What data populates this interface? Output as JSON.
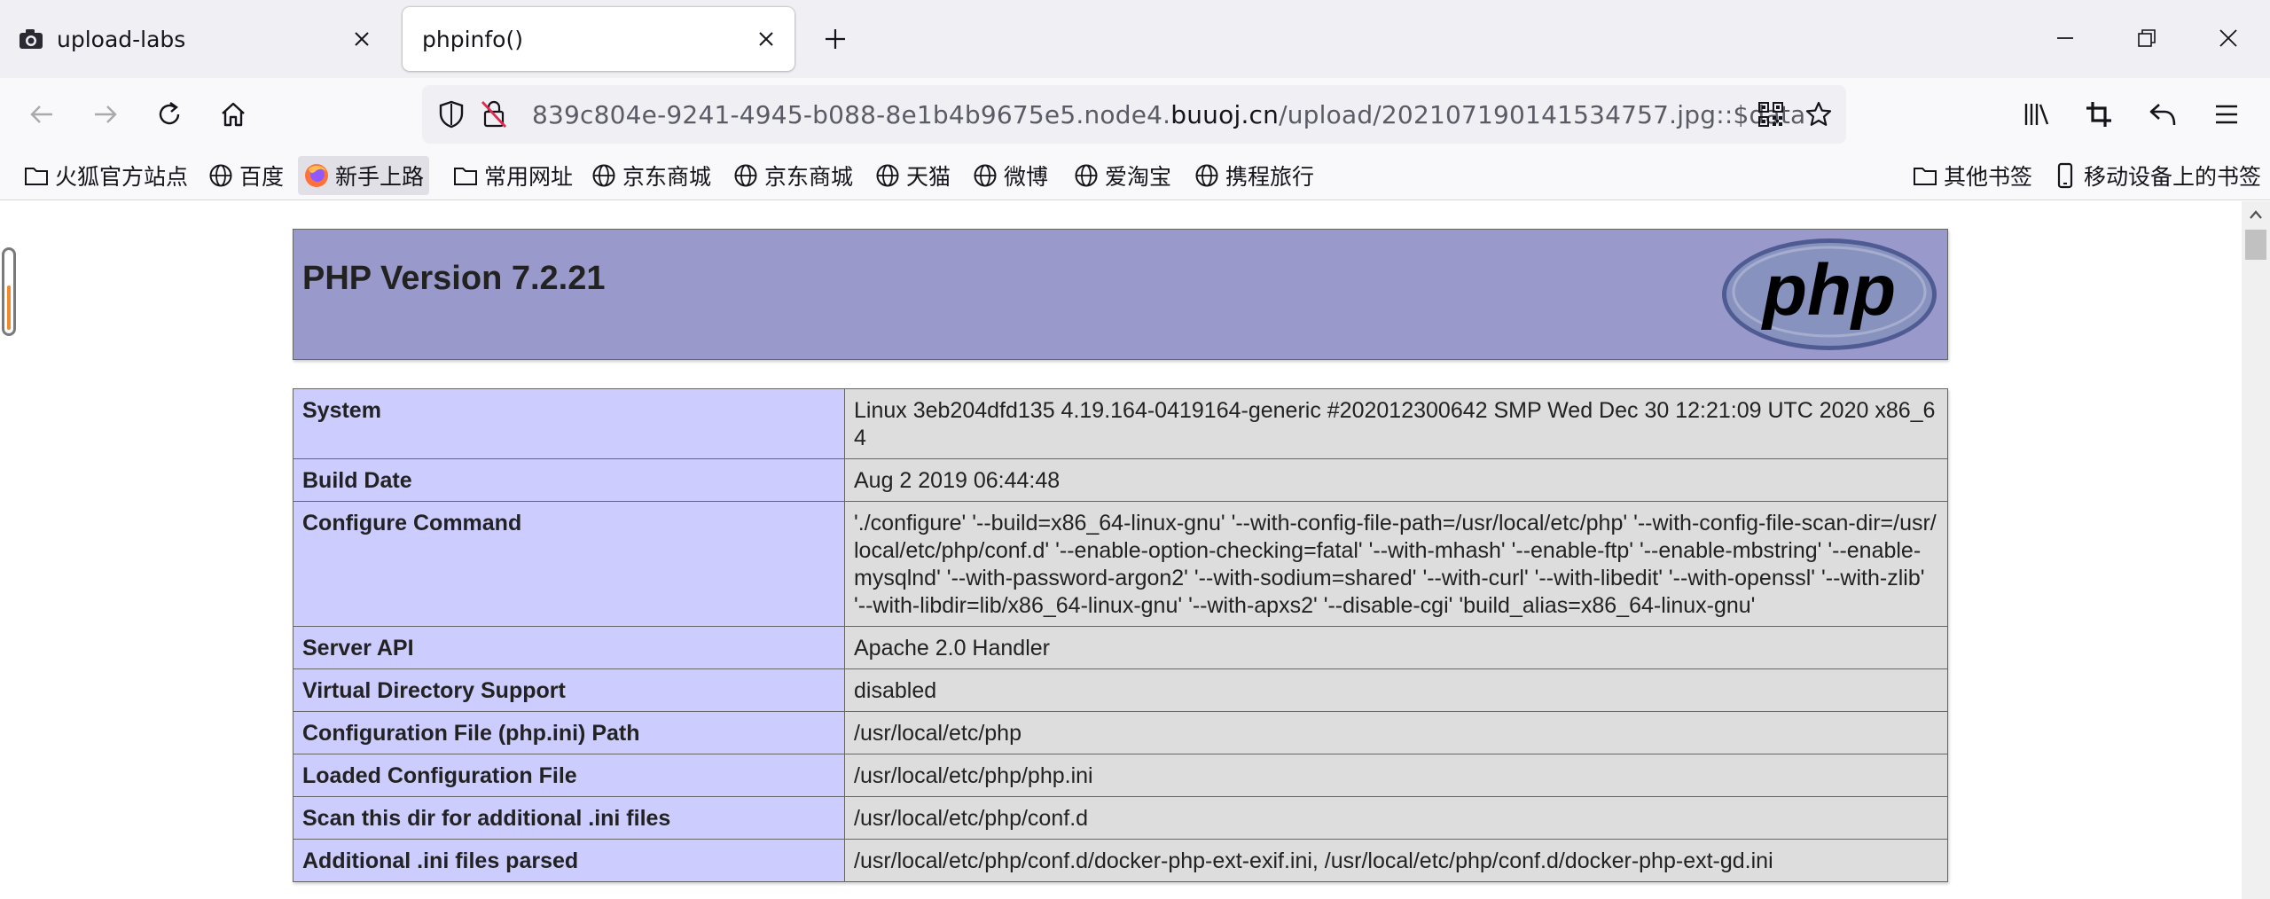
{
  "tabs": [
    {
      "label": "upload-labs",
      "active": false,
      "icon": "camera-icon"
    },
    {
      "label": "phpinfo()",
      "active": true,
      "icon": ""
    }
  ],
  "address": {
    "prefix": "839c804e-9241-4945-b088-8e1b4b9675e5.node4.",
    "domain": "buuoj.cn",
    "path": "/upload/202107190141534757.jpg::$data"
  },
  "bookmarks": {
    "left": [
      {
        "label": "火狐官方站点",
        "icon": "folder-icon"
      },
      {
        "label": "百度",
        "icon": "globe-icon"
      },
      {
        "label": "新手上路",
        "icon": "firefox-icon"
      },
      {
        "label": "常用网址",
        "icon": "folder-icon"
      },
      {
        "label": "京东商城",
        "icon": "globe-icon"
      },
      {
        "label": "京东商城",
        "icon": "globe-icon"
      },
      {
        "label": "天猫",
        "icon": "globe-icon"
      },
      {
        "label": "微博",
        "icon": "globe-icon"
      },
      {
        "label": "爱淘宝",
        "icon": "globe-icon"
      },
      {
        "label": "携程旅行",
        "icon": "globe-icon"
      }
    ],
    "right": [
      {
        "label": "其他书签",
        "icon": "folder-icon"
      },
      {
        "label": "移动设备上的书签",
        "icon": "mobile-icon"
      }
    ]
  },
  "phpinfo": {
    "title": "PHP Version 7.2.21",
    "logo_text": "php",
    "rows": [
      {
        "key": "System",
        "value": "Linux 3eb204dfd135 4.19.164-0419164-generic #202012300642 SMP Wed Dec 30 12:21:09 UTC 2020 x86_64"
      },
      {
        "key": "Build Date",
        "value": "Aug 2 2019 06:44:48"
      },
      {
        "key": "Configure Command",
        "value": "'./configure' '--build=x86_64-linux-gnu' '--with-config-file-path=/usr/local/etc/php' '--with-config-file-scan-dir=/usr/local/etc/php/conf.d' '--enable-option-checking=fatal' '--with-mhash' '--enable-ftp' '--enable-mbstring' '--enable-mysqlnd' '--with-password-argon2' '--with-sodium=shared' '--with-curl' '--with-libedit' '--with-openssl' '--with-zlib' '--with-libdir=lib/x86_64-linux-gnu' '--with-apxs2' '--disable-cgi' 'build_alias=x86_64-linux-gnu'"
      },
      {
        "key": "Server API",
        "value": "Apache 2.0 Handler"
      },
      {
        "key": "Virtual Directory Support",
        "value": "disabled"
      },
      {
        "key": "Configuration File (php.ini) Path",
        "value": "/usr/local/etc/php"
      },
      {
        "key": "Loaded Configuration File",
        "value": "/usr/local/etc/php/php.ini"
      },
      {
        "key": "Scan this dir for additional .ini files",
        "value": "/usr/local/etc/php/conf.d"
      },
      {
        "key": "Additional .ini files parsed",
        "value": "/usr/local/etc/php/conf.d/docker-php-ext-exif.ini, /usr/local/etc/php/conf.d/docker-php-ext-gd.ini"
      }
    ]
  },
  "colors": {
    "header_bg": "#9999cc",
    "key_bg": "#ccccff",
    "value_bg": "#dddddd",
    "tabstrip_bg": "#f0f0f4"
  }
}
